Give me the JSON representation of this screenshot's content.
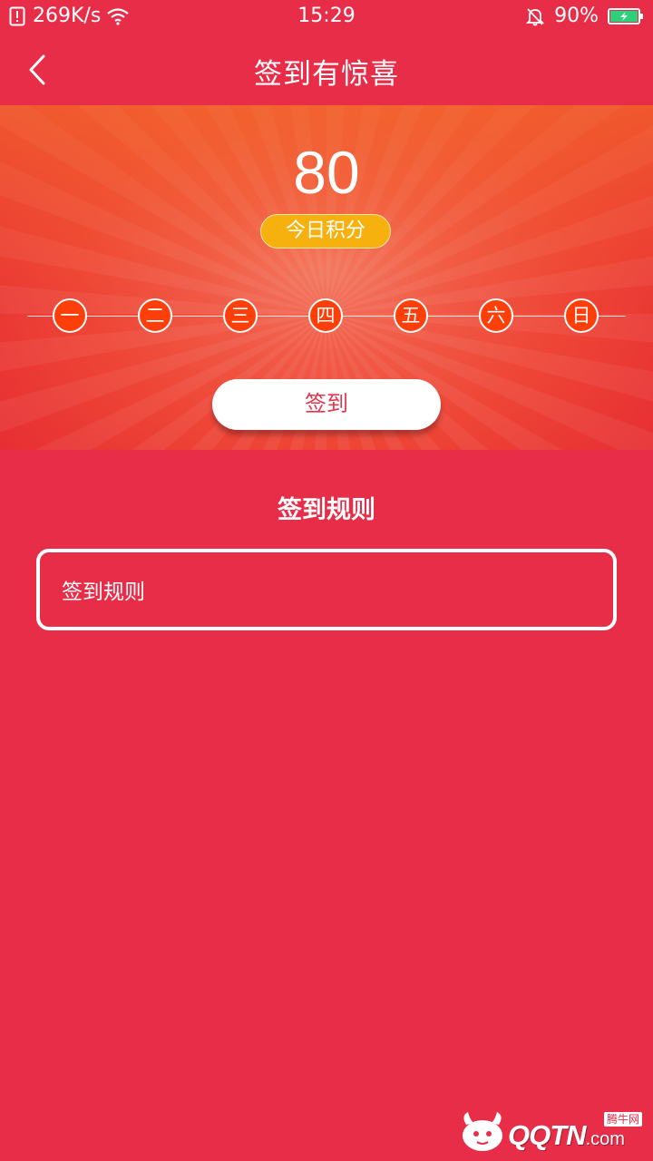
{
  "status_bar": {
    "network_speed": "269K/s",
    "time": "15:29",
    "battery": "90%"
  },
  "header": {
    "title": "签到有惊喜"
  },
  "hero": {
    "points": "80",
    "points_label": "今日积分",
    "days": [
      "一",
      "二",
      "三",
      "四",
      "五",
      "六",
      "日"
    ],
    "signin_label": "签到"
  },
  "rules": {
    "heading": "签到规则",
    "content": "签到规则"
  },
  "watermark": {
    "brand": "QQTN",
    "domain": ".com",
    "tag": "腾牛网"
  },
  "colors": {
    "background": "#e82d48",
    "day_circle": "#ff3f0a",
    "badge": "#f6b10f",
    "button_text": "#e5354c"
  }
}
